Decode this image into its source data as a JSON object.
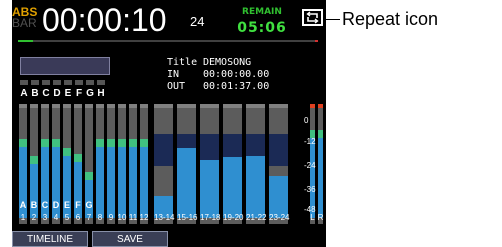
{
  "header": {
    "time_mode_primary": "ABS",
    "time_mode_secondary": "BAR",
    "time": "00:00:10",
    "frames": "24",
    "remain_label": "REMAIN",
    "remain_value": "05:06",
    "progress_fraction": 0.05
  },
  "song": {
    "title_label": "Title",
    "title_value": "DEMOSONG",
    "in_label": "IN",
    "in_value": "00:00:00.00",
    "out_label": "OUT",
    "out_value": "00:01:37.00"
  },
  "assign_letters": [
    "A",
    "B",
    "C",
    "D",
    "E",
    "F",
    "G",
    "H"
  ],
  "meters": {
    "scale": [
      "0",
      "-12",
      "-24",
      "-36",
      "-48"
    ],
    "bus_letters": [
      "A",
      "B",
      "C",
      "D",
      "E",
      "F",
      "G"
    ],
    "tracks": [
      "1",
      "2",
      "3",
      "4",
      "5",
      "6",
      "7",
      "8",
      "9",
      "10",
      "11",
      "12",
      "13-14",
      "15-16",
      "17-18",
      "19-20",
      "21-22",
      "23-24",
      "L",
      "R"
    ],
    "levels": [
      0.72,
      0.56,
      0.72,
      0.72,
      0.64,
      0.58,
      0.42,
      0.72,
      0.72,
      0.72,
      0.72,
      0.72,
      0.2,
      0.64,
      0.53,
      0.55,
      0.56,
      0.38,
      0.8,
      0.8
    ]
  },
  "buttons": {
    "timeline": "TIMELINE",
    "save": "SAVE"
  },
  "callout": {
    "label": "Repeat icon"
  },
  "colors": {
    "meter_level": "#2f8fd0",
    "meter_peak_red": "#e04020",
    "remain": "#40e040",
    "abs": "#e0a000"
  },
  "icons": {
    "repeat": "repeat-icon"
  }
}
